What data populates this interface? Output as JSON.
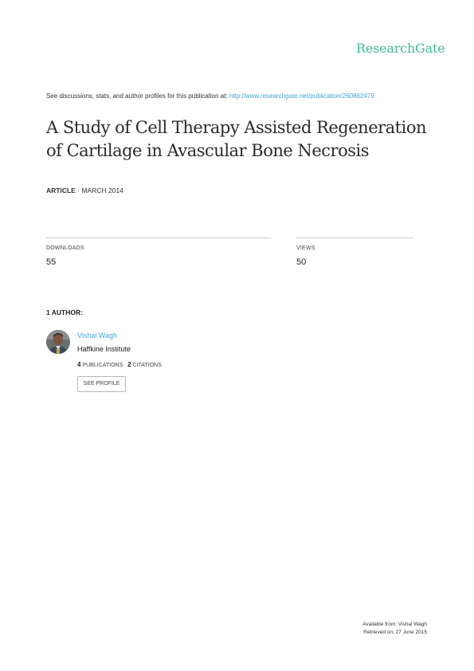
{
  "brand": {
    "logo_text": "ResearchGate",
    "accent_color": "#40ba9b",
    "link_color": "#41a4d9"
  },
  "header": {
    "discussion_text": "See discussions, stats, and author profiles for this publication at:",
    "publication_url": "http://www.researchgate.net/publication/260862479"
  },
  "publication": {
    "title": "A Study of Cell Therapy Assisted Regeneration of Cartilage in Avascular Bone Necrosis",
    "type": "ARTICLE",
    "date": "· MARCH 2014"
  },
  "stats": {
    "downloads_label": "DOWNLOADS",
    "downloads_value": "55",
    "views_label": "VIEWS",
    "views_value": "50"
  },
  "authors": {
    "heading": "1 AUTHOR:",
    "items": [
      {
        "name": "Vishal Wagh",
        "institution": "Haffkine Institute",
        "publications_count": "4",
        "publications_label": "PUBLICATIONS",
        "citations_count": "2",
        "citations_label": "CITATIONS",
        "see_profile_label": "SEE PROFILE"
      }
    ]
  },
  "footer": {
    "available_from": "Available from: Vishal Wagh",
    "retrieved_on": "Retrieved on: 27 June 2015"
  }
}
